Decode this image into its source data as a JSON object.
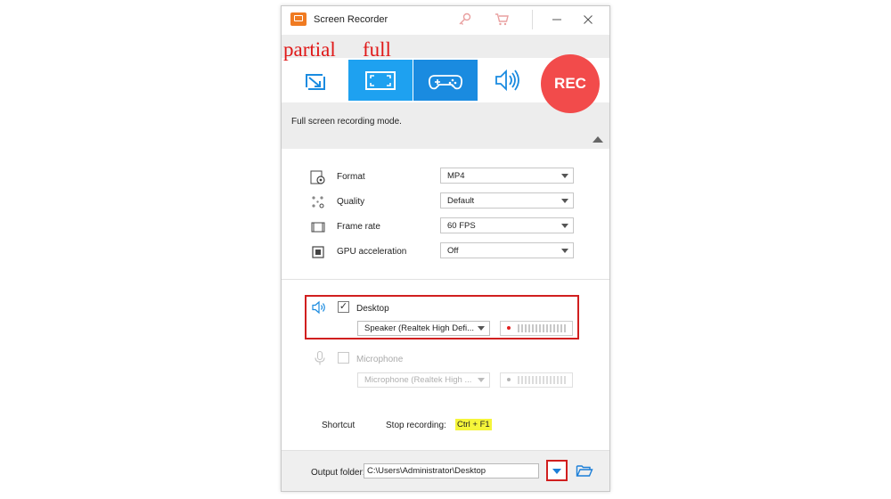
{
  "window": {
    "title": "Screen Recorder",
    "icons": [
      "key-icon",
      "cart-icon"
    ],
    "controls": [
      "minimize-icon",
      "close-icon"
    ]
  },
  "annotations": {
    "partial": "partial",
    "full": "full"
  },
  "modes": {
    "items": [
      {
        "name": "partial-screen-mode",
        "icon": "partial-screen-icon",
        "active": false
      },
      {
        "name": "full-screen-mode",
        "icon": "full-screen-icon",
        "active": true
      },
      {
        "name": "game-mode",
        "icon": "gamepad-icon",
        "active": false
      },
      {
        "name": "audio-only-mode",
        "icon": "speaker-icon",
        "active": false
      }
    ],
    "rec_label": "REC",
    "description": "Full screen recording mode."
  },
  "settings": {
    "format": {
      "label": "Format",
      "value": "MP4"
    },
    "quality": {
      "label": "Quality",
      "value": "Default"
    },
    "frame_rate": {
      "label": "Frame rate",
      "value": "60 FPS"
    },
    "gpu": {
      "label": "GPU acceleration",
      "value": "Off"
    }
  },
  "audio": {
    "desktop": {
      "label": "Desktop",
      "checked": true,
      "device": "Speaker (Realtek High Defi..."
    },
    "microphone": {
      "label": "Microphone",
      "checked": false,
      "device": "Microphone (Realtek High ..."
    }
  },
  "shortcut": {
    "label": "Shortcut",
    "action": "Stop recording:",
    "key": "Ctrl + F1"
  },
  "output": {
    "label": "Output folder:",
    "path": "C:\\Users\\Administrator\\Desktop"
  },
  "colors": {
    "accent": "#1ea1f0",
    "rec": "#f24b4b",
    "highlight_box": "#d11f1f",
    "shortcut_highlight": "#f5f53a"
  }
}
